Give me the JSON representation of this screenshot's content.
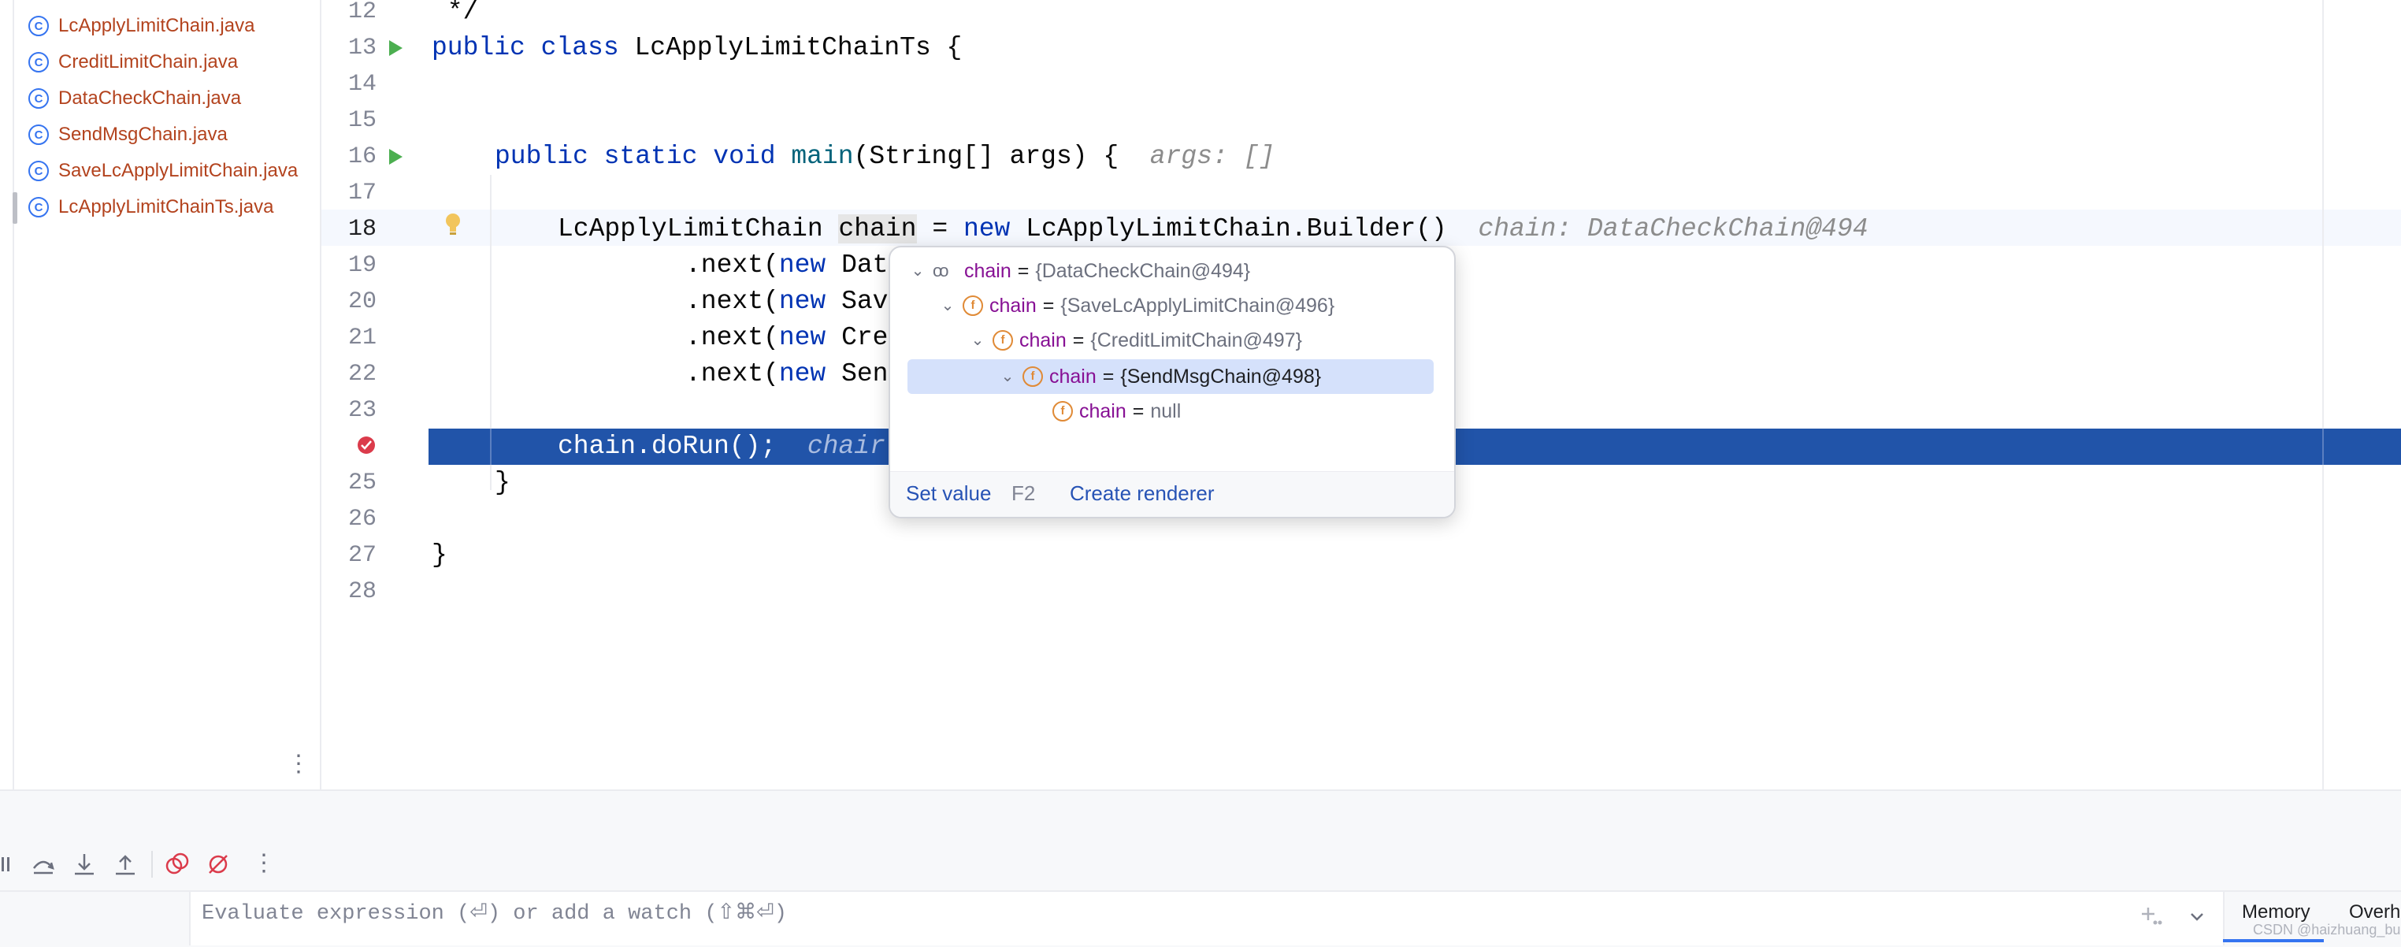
{
  "sidebar": {
    "files": [
      {
        "name": "LcApplyLimitChain.java",
        "icon": "class-icon"
      },
      {
        "name": "CreditLimitChain.java",
        "icon": "class-icon"
      },
      {
        "name": "DataCheckChain.java",
        "icon": "class-icon"
      },
      {
        "name": "SendMsgChain.java",
        "icon": "class-icon"
      },
      {
        "name": "SaveLcApplyLimitChain.java",
        "icon": "class-icon"
      },
      {
        "name": "LcApplyLimitChainTs.java",
        "icon": "class-icon",
        "selected": true
      }
    ]
  },
  "editor": {
    "line_numbers": [
      "12",
      "13",
      "14",
      "15",
      "16",
      "17",
      "18",
      "19",
      "20",
      "21",
      "22",
      "23",
      "25",
      "26",
      "27",
      "28"
    ],
    "current_line": "18",
    "lines": {
      "l12": " */",
      "l13_kw1": "public",
      "l13_kw2": "class",
      "l13_rest": "LcApplyLimitChainTs {",
      "l16_kw1": "public",
      "l16_kw2": "static",
      "l16_kw3": "void",
      "l16_fn": "main",
      "l16_rest": "(String[] args) {",
      "l16_hint": "args: []",
      "l18_type": "LcApplyLimitChain",
      "l18_var": "chain",
      "l18_eq": "=",
      "l18_kw": "new",
      "l18_rest": "LcApplyLimitChain.Builder()",
      "l18_hint": "chain: DataCheckChain@494",
      "l19_a": ".next(",
      "l19_kw": "new",
      "l19_b": "Dat",
      "l20_a": ".next(",
      "l20_kw": "new",
      "l20_b": "Sav",
      "l21_a": ".next(",
      "l21_kw": "new",
      "l21_b": "Cre",
      "l22_a": ".next(",
      "l22_kw": "new",
      "l22_b": "Sen",
      "l24_code": "chain.doRun();",
      "l24_hint": "chair",
      "l25": "}",
      "l27": "}"
    }
  },
  "popup": {
    "rows": [
      {
        "name": "chain",
        "eq": "=",
        "value": "{DataCheckChain@494}",
        "icon": "watch-glasses-icon",
        "expanded": true
      },
      {
        "name": "chain",
        "eq": "=",
        "value": "{SaveLcApplyLimitChain@496}",
        "icon": "field-icon",
        "expanded": true
      },
      {
        "name": "chain",
        "eq": "=",
        "value": "{CreditLimitChain@497}",
        "icon": "field-icon",
        "expanded": true
      },
      {
        "name": "chain",
        "eq": "=",
        "value": "{SendMsgChain@498}",
        "icon": "field-icon",
        "expanded": true,
        "selected": true
      },
      {
        "name": "chain",
        "eq": "=",
        "value": "null",
        "icon": "field-icon",
        "expanded": false
      }
    ],
    "footer": {
      "set_value": "Set value",
      "set_value_key": "F2",
      "create_renderer": "Create renderer"
    }
  },
  "debug": {
    "eval_placeholder": "Evaluate expression (⏎) or add a watch (⇧⌘⏎)",
    "tabs": [
      "Memory",
      "Overhe"
    ],
    "watermark": "CSDN @haizhuang_bu"
  },
  "colors": {
    "keyword": "#0033b3",
    "exec_line": "#2154a9",
    "field_icon": "#e08a36",
    "link": "#2753b5"
  }
}
